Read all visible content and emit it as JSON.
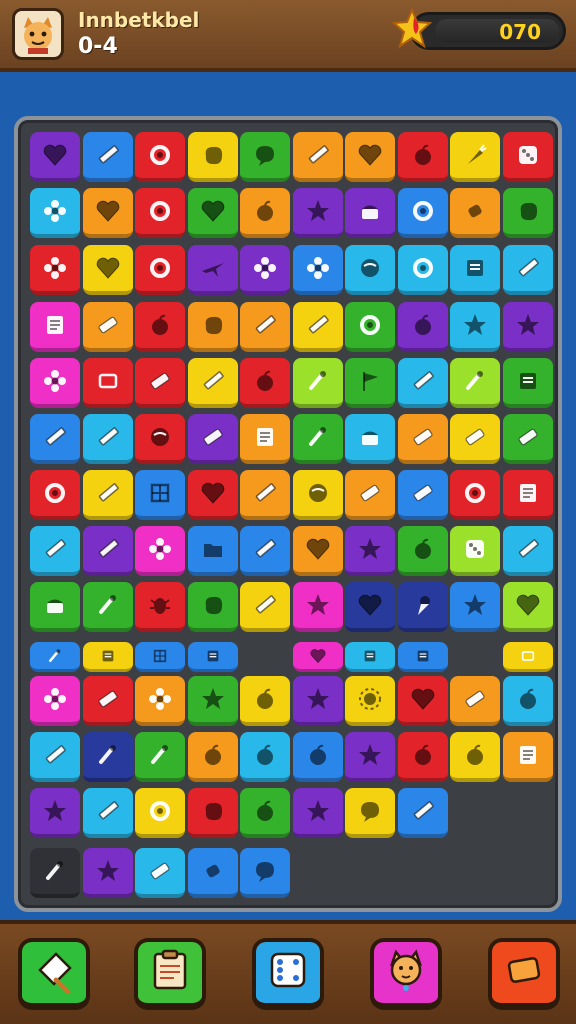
{
  "header": {
    "title": "Innbetkbel",
    "score_left": "0-4",
    "score_value": "070"
  },
  "colors": {
    "purple": "#7a2fc6",
    "blue": "#2b86ea",
    "red": "#e3232a",
    "yellow": "#f5d20f",
    "green": "#34b22c",
    "orange": "#f59a1c",
    "pink": "#ef2fc6",
    "cyan": "#28b9ea",
    "lime": "#9be02a",
    "navy": "#283a9c",
    "dark": "#2f3136"
  },
  "board": {
    "rows": [
      [
        [
          "purple",
          "heart"
        ],
        [
          "blue",
          "pencil"
        ],
        [
          "red",
          "ring"
        ],
        [
          "yellow",
          "blob"
        ],
        [
          "green",
          "bubble"
        ],
        [
          "orange",
          "pencil"
        ],
        [
          "orange",
          "heart"
        ],
        [
          "red",
          "apple"
        ],
        [
          "yellow",
          "carrot"
        ],
        [
          "red",
          "dice"
        ]
      ],
      [
        [
          "cyan",
          "flower"
        ],
        [
          "orange",
          "heart"
        ],
        [
          "red",
          "ring"
        ],
        [
          "green",
          "heart"
        ],
        [
          "orange",
          "apple"
        ],
        [
          "purple",
          "star"
        ],
        [
          "purple",
          "cake"
        ],
        [
          "blue",
          "ring"
        ],
        [
          "orange",
          "candy"
        ],
        [
          "green",
          "blob"
        ]
      ],
      [
        [
          "red",
          "flower"
        ],
        [
          "yellow",
          "heart"
        ],
        [
          "red",
          "ring"
        ],
        [
          "purple",
          "plane"
        ],
        [
          "purple",
          "flower"
        ],
        [
          "blue",
          "flower"
        ],
        [
          "cyan",
          "ball"
        ],
        [
          "cyan",
          "ring"
        ],
        [
          "cyan",
          "book"
        ],
        [
          "cyan",
          "pencil"
        ]
      ],
      [
        [
          "pink",
          "note"
        ],
        [
          "orange",
          "eraser"
        ],
        [
          "red",
          "apple"
        ],
        [
          "orange",
          "blob"
        ],
        [
          "orange",
          "pencil"
        ],
        [
          "yellow",
          "pencil"
        ],
        [
          "green",
          "ring"
        ],
        [
          "purple",
          "apple"
        ],
        [
          "cyan",
          "star"
        ],
        [
          "purple",
          "star"
        ]
      ],
      [
        [
          "pink",
          "flower"
        ],
        [
          "red",
          "rect"
        ],
        [
          "red",
          "eraser"
        ],
        [
          "yellow",
          "pencil"
        ],
        [
          "red",
          "apple"
        ],
        [
          "lime",
          "brush"
        ],
        [
          "green",
          "flag"
        ],
        [
          "cyan",
          "pencil"
        ],
        [
          "lime",
          "brush"
        ],
        [
          "green",
          "book"
        ]
      ],
      [
        [
          "blue",
          "pencil"
        ],
        [
          "cyan",
          "pencil"
        ],
        [
          "red",
          "ball"
        ],
        [
          "purple",
          "eraser"
        ],
        [
          "orange",
          "note"
        ],
        [
          "green",
          "brush"
        ],
        [
          "cyan",
          "cake"
        ],
        [
          "orange",
          "eraser"
        ],
        [
          "yellow",
          "eraser"
        ],
        [
          "green",
          "eraser"
        ]
      ],
      [
        [
          "red",
          "ring"
        ],
        [
          "yellow",
          "pencil"
        ],
        [
          "blue",
          "window"
        ],
        [
          "red",
          "heart"
        ],
        [
          "orange",
          "pencil"
        ],
        [
          "yellow",
          "ball"
        ],
        [
          "orange",
          "eraser"
        ],
        [
          "blue",
          "eraser"
        ],
        [
          "red",
          "ring"
        ],
        [
          "red",
          "note"
        ]
      ],
      [
        [
          "cyan",
          "pencil"
        ],
        [
          "purple",
          "pencil"
        ],
        [
          "pink",
          "flower"
        ],
        [
          "blue",
          "folder"
        ],
        [
          "blue",
          "pencil"
        ],
        [
          "orange",
          "heart"
        ],
        [
          "purple",
          "star"
        ],
        [
          "green",
          "apple"
        ],
        [
          "lime",
          "dice"
        ],
        [
          "cyan",
          "pencil"
        ]
      ],
      [
        [
          "green",
          "cake"
        ],
        [
          "green",
          "brush"
        ],
        [
          "red",
          "bug"
        ],
        [
          "green",
          "blob"
        ],
        [
          "yellow",
          "pencil"
        ],
        [
          "pink",
          "star"
        ],
        [
          "navy",
          "heart"
        ],
        [
          "navy",
          "cone"
        ],
        [
          "blue",
          "star"
        ],
        [
          "lime",
          "heart"
        ]
      ]
    ],
    "small_row": [
      [
        "blue",
        "brush",
        0
      ],
      [
        "yellow",
        "book",
        1
      ],
      [
        "blue",
        "window",
        2
      ],
      [
        "blue",
        "book",
        3
      ],
      [
        "pink",
        "heart",
        5
      ],
      [
        "cyan",
        "book",
        6
      ],
      [
        "blue",
        "book",
        7
      ],
      [
        "yellow",
        "rect",
        9
      ]
    ],
    "rows_lower": [
      [
        [
          "pink",
          "flower"
        ],
        [
          "red",
          "eraser"
        ],
        [
          "orange",
          "flower"
        ],
        [
          "green",
          "star"
        ],
        [
          "yellow",
          "apple"
        ],
        [
          "purple",
          "star"
        ],
        [
          "yellow",
          "sun"
        ],
        [
          "red",
          "heart"
        ],
        [
          "orange",
          "eraser"
        ],
        [
          "cyan",
          "apple"
        ]
      ],
      [
        [
          "cyan",
          "pencil"
        ],
        [
          "navy",
          "brush"
        ],
        [
          "green",
          "brush"
        ],
        [
          "orange",
          "apple"
        ],
        [
          "cyan",
          "apple"
        ],
        [
          "blue",
          "apple"
        ],
        [
          "purple",
          "star"
        ],
        [
          "red",
          "apple"
        ],
        [
          "yellow",
          "apple"
        ],
        [
          "orange",
          "note"
        ]
      ],
      [
        [
          "purple",
          "star"
        ],
        [
          "cyan",
          "pencil"
        ],
        [
          "yellow",
          "ring"
        ],
        [
          "red",
          "blob"
        ],
        [
          "green",
          "apple"
        ],
        [
          "purple",
          "star"
        ],
        [
          "yellow",
          "bubble"
        ],
        [
          "blue",
          "pencil"
        ],
        null,
        null
      ],
      [
        [
          "dark",
          "brush"
        ],
        [
          "purple",
          "star"
        ],
        [
          "cyan",
          "eraser"
        ],
        [
          "blue",
          "candy"
        ],
        [
          "blue",
          "bubble"
        ],
        null,
        null,
        null,
        null,
        null
      ]
    ]
  },
  "bottom_buttons": [
    {
      "name": "paper-pencil-button",
      "color": "#2fbf3a",
      "icon": "paper"
    },
    {
      "name": "clipboard-button",
      "color": "#3fc23a",
      "icon": "clipboard"
    },
    {
      "name": "dice-button",
      "color": "#2aa6e6",
      "icon": "dice"
    },
    {
      "name": "cat-button",
      "color": "#e633c9",
      "icon": "cat"
    },
    {
      "name": "eraser-button",
      "color": "#ef4a1e",
      "icon": "eraser"
    }
  ]
}
